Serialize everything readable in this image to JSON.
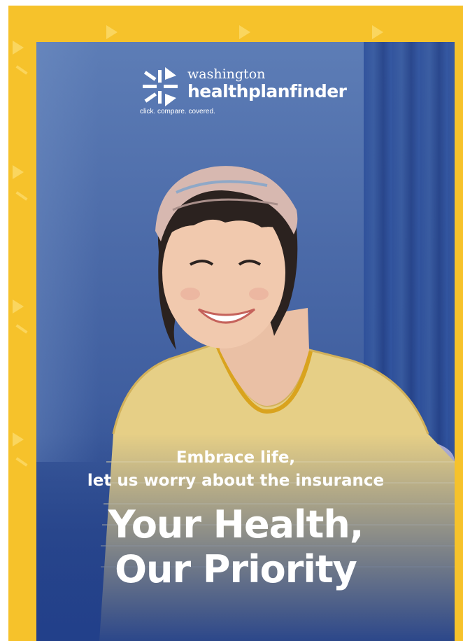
{
  "ad": {
    "logo": {
      "line1": "washington",
      "line2": "healthplanfinder",
      "tagline": "click. compare. covered."
    },
    "tagline_line1": "Embrace life,",
    "tagline_line2": "let us worry about the insurance",
    "title_line1": "Your Health,",
    "title_line2": "Our Priority"
  },
  "colors": {
    "frame": "#f6c22b",
    "panel": "#3f5e9f",
    "text": "#ffffff"
  }
}
